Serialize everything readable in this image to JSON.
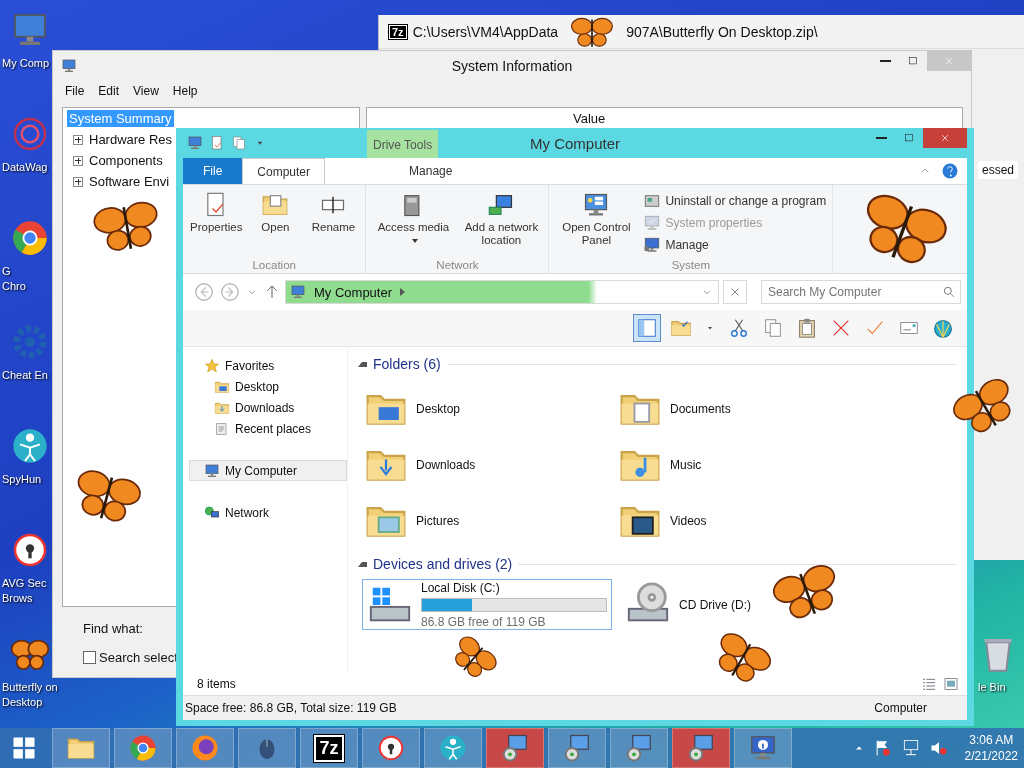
{
  "desktop_icons": [
    {
      "kind": "computer",
      "lines": [
        "My Comp"
      ]
    },
    {
      "kind": "sphere",
      "lines": [
        "DataWag"
      ]
    },
    {
      "kind": "chrome",
      "lines": [
        "G",
        "Chro"
      ]
    },
    {
      "kind": "gear",
      "lines": [
        "Cheat En"
      ]
    },
    {
      "kind": "person",
      "lines": [
        "SpyHun"
      ]
    },
    {
      "kind": "lock",
      "lines": [
        "AVG Sec",
        "Brows"
      ]
    },
    {
      "kind": "butterfly",
      "lines": [
        "Butterfly on",
        "Desktop"
      ]
    }
  ],
  "recycle_bin": {
    "kind": "bin",
    "label": "le Bin"
  },
  "archive_window": {
    "icon_text": "7z",
    "title_parts": [
      "C:\\Users\\VM4\\AppData",
      "907A\\Butterfly On Desktop.zip\\"
    ],
    "column_3": "essed"
  },
  "sysinfo_window": {
    "title": "System Information",
    "menu": [
      "File",
      "Edit",
      "View",
      "Help"
    ],
    "tree": [
      {
        "label": "System Summary",
        "selected": true,
        "children": [
          {
            "label": "Hardware Res",
            "selected": false,
            "expanded": false
          },
          {
            "label": "Components",
            "selected": false,
            "expanded": false
          },
          {
            "label": "Software Envi",
            "selected": false,
            "expanded": false
          }
        ]
      }
    ],
    "columns": [
      "Value"
    ],
    "find_label": "Find what:",
    "search_selected": {
      "label": "Search select",
      "checked": false
    }
  },
  "explorer": {
    "title": "My Computer",
    "contextual_header": "Drive Tools",
    "tabs": [
      {
        "kind": "file",
        "label": "File",
        "selected": false
      },
      {
        "kind": "tab",
        "label": "Computer",
        "selected": true
      },
      {
        "kind": "contextual",
        "label": "Manage",
        "selected": false
      }
    ],
    "ribbon_groups": [
      {
        "label": "Location",
        "large": [
          {
            "kind": "properties",
            "label": "Properties",
            "dropdown": false
          },
          {
            "kind": "open",
            "label": "Open",
            "dropdown": false
          },
          {
            "kind": "rename",
            "label": "Rename",
            "dropdown": false
          }
        ]
      },
      {
        "label": "Network",
        "large": [
          {
            "kind": "media",
            "label": "Access media",
            "dropdown": true
          },
          {
            "kind": "netloc",
            "label": "Add a network location",
            "dropdown": false
          }
        ]
      },
      {
        "label": "System",
        "large": [
          {
            "kind": "control",
            "label": "Open Control Panel",
            "dropdown": false
          }
        ],
        "small": [
          {
            "kind": "uninstall",
            "label": "Uninstall or change a program",
            "disabled": false
          },
          {
            "kind": "sysprops",
            "label": "System properties",
            "disabled": true
          },
          {
            "kind": "manage",
            "label": "Manage",
            "disabled": false
          }
        ]
      }
    ],
    "address": "My Computer",
    "search": {
      "placeholder": "Search My Computer"
    },
    "toolbar": [
      {
        "kind": "pane",
        "selected": true
      },
      {
        "kind": "folder-check",
        "selected": false
      },
      {
        "kind": "caret",
        "selected": false
      },
      {
        "kind": "scissors",
        "selected": false
      },
      {
        "kind": "copy",
        "selected": false
      },
      {
        "kind": "paste",
        "selected": false
      },
      {
        "kind": "delete",
        "selected": false
      },
      {
        "kind": "check",
        "selected": false
      },
      {
        "kind": "envelope",
        "selected": false
      },
      {
        "kind": "shell",
        "selected": false
      }
    ],
    "nav": [
      {
        "kind": "star",
        "label": "Favorites",
        "selected": false,
        "children": [
          {
            "kind": "desktop",
            "label": "Desktop",
            "selected": false
          },
          {
            "kind": "downloads",
            "label": "Downloads",
            "selected": false
          },
          {
            "kind": "recent",
            "label": "Recent places",
            "selected": false
          }
        ]
      },
      {
        "kind": "computer",
        "label": "My Computer",
        "selected": true
      },
      {
        "kind": "network",
        "label": "Network",
        "selected": false
      }
    ],
    "folders": {
      "title": "Folders (6)",
      "expanded": true,
      "items": [
        {
          "kind": "desktop",
          "label": "Desktop"
        },
        {
          "kind": "documents",
          "label": "Documents"
        },
        {
          "kind": "downloads",
          "label": "Downloads"
        },
        {
          "kind": "music",
          "label": "Music"
        },
        {
          "kind": "pictures",
          "label": "Pictures"
        },
        {
          "kind": "videos",
          "label": "Videos"
        }
      ]
    },
    "drives": {
      "title": "Devices and drives (2)",
      "expanded": true,
      "items": [
        {
          "kind": "hdd",
          "label": "Local Disk (C:)",
          "level": 0.27,
          "free": "86.8 GB free of 119 GB",
          "selected": true
        },
        {
          "kind": "cd",
          "label": "CD Drive (D:)",
          "selected": false
        }
      ]
    },
    "status": "8 items",
    "details": [
      "Space free: 86.8 GB, Total size: 119 GB",
      "Computer"
    ]
  },
  "taskbar": {
    "items": [
      {
        "kind": "explorer",
        "alert": false
      },
      {
        "kind": "chrome",
        "alert": false
      },
      {
        "kind": "firefox",
        "alert": false
      },
      {
        "kind": "mouse",
        "alert": false
      },
      {
        "kind": "sevenzip",
        "label": "7z",
        "alert": false
      },
      {
        "kind": "lock",
        "alert": false
      },
      {
        "kind": "person",
        "alert": false
      },
      {
        "kind": "setup",
        "alert": true
      },
      {
        "kind": "setup",
        "alert": false
      },
      {
        "kind": "setup",
        "alert": false
      },
      {
        "kind": "setup",
        "alert": true
      },
      {
        "kind": "info",
        "alert": false
      }
    ],
    "tray": [
      {
        "kind": "up"
      },
      {
        "kind": "flag"
      },
      {
        "kind": "net"
      },
      {
        "kind": "volume"
      }
    ],
    "time": "3:06 AM",
    "date": "2/21/2022"
  }
}
